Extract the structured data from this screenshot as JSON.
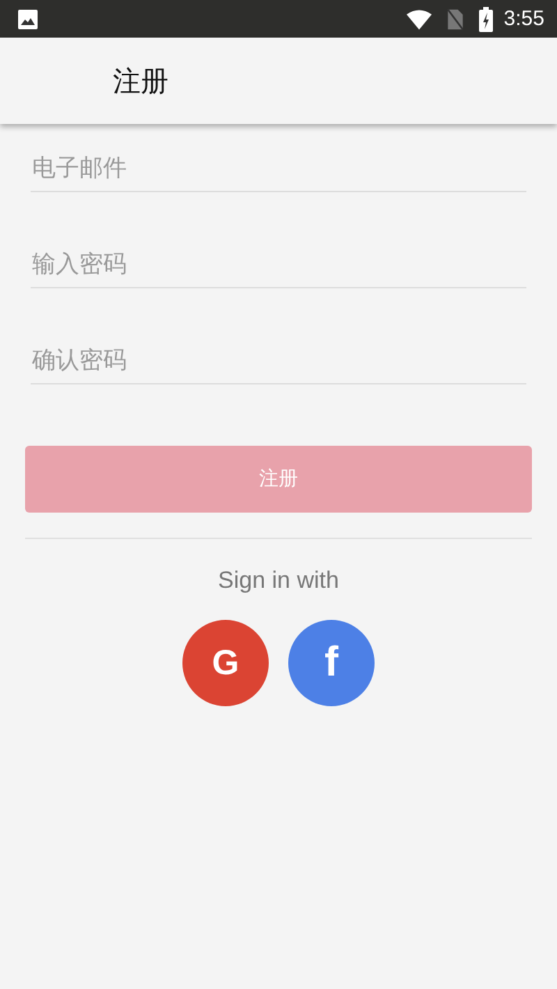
{
  "status_bar": {
    "time": "3:55"
  },
  "app_bar": {
    "title": "注册"
  },
  "fields": [
    {
      "placeholder": "电子邮件"
    },
    {
      "placeholder": "输入密码"
    },
    {
      "placeholder": "确认密码"
    }
  ],
  "submit_button": {
    "label": "注册",
    "disabled": true
  },
  "sign_in_with": "Sign in with",
  "social_buttons": [
    {
      "kind": "google",
      "label": "G",
      "color": "#db4433"
    },
    {
      "kind": "facebook",
      "label": "f",
      "color": "#4d80e6"
    }
  ]
}
